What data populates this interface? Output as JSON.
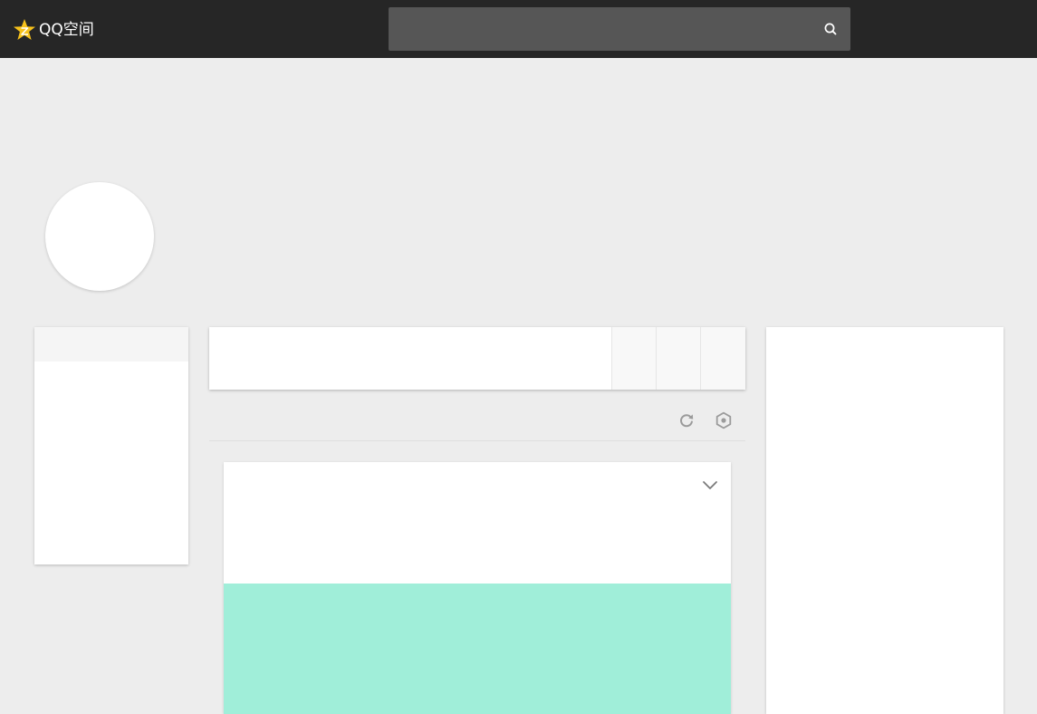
{
  "header": {
    "logo_text": "QQ空间",
    "search": {
      "value": "",
      "placeholder": ""
    }
  },
  "colors": {
    "topbar": "#262626",
    "search_bg": "#565656",
    "logo_star": "#f7c21b",
    "page_bg": "#ededed",
    "icon_gray": "#9b9b9b",
    "feed_media": "#a0eed9"
  },
  "icons": {
    "logo": "qzone-star-icon",
    "search": "search-icon",
    "refresh": "refresh-icon",
    "settings": "settings-hex-icon",
    "expand": "chevron-down-icon"
  }
}
